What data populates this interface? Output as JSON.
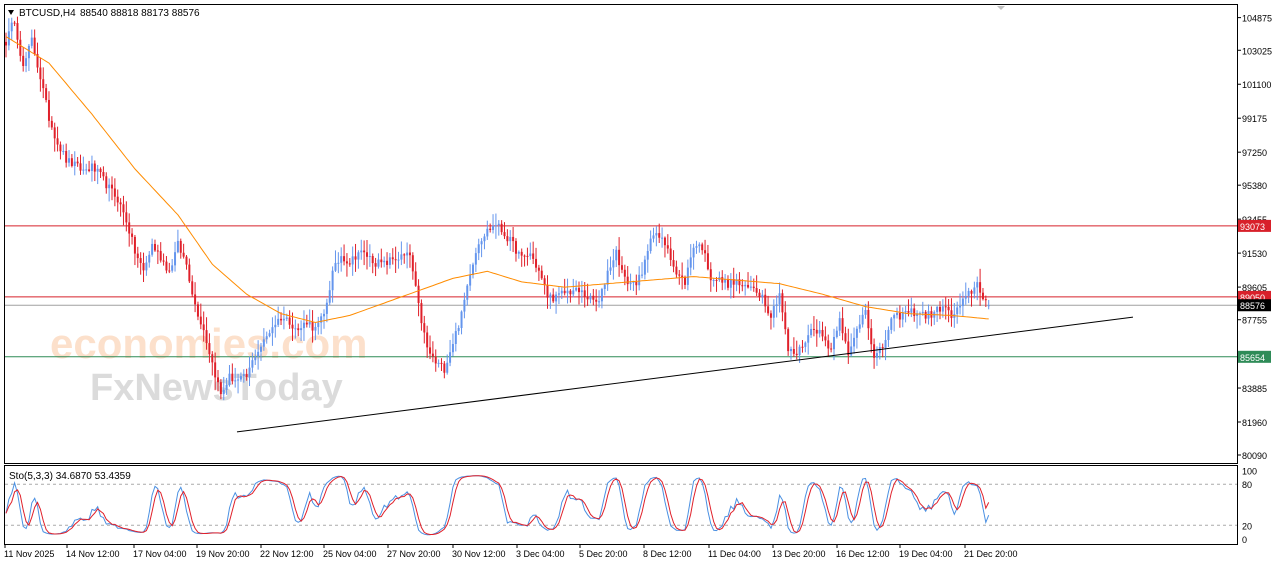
{
  "header": {
    "symbol": "BTCUSD,H4",
    "ohlc": "88540 88818 88173 88576",
    "menu_icon": "triangle-down-icon"
  },
  "watermark": {
    "line1": "economies.com",
    "line2": "FxNewsToday"
  },
  "colors": {
    "bull": "#6495ed",
    "bear": "#e0202a",
    "ma": "#ff8c00",
    "resistance": "#d8202a",
    "support": "#2e8b57",
    "price_line": "#a0a0a0",
    "trendline": "#000000",
    "stoch_main": "#4a90e2",
    "stoch_signal": "#e0202a"
  },
  "chart_data": [
    {
      "type": "candlestick",
      "title": "BTCUSD,H4",
      "ylim": [
        80090,
        105800
      ],
      "y_ticks": [
        "104875",
        "103025",
        "101100",
        "99175",
        "97250",
        "95380",
        "93455",
        "91530",
        "89605",
        "87755",
        "85830",
        "83885",
        "81960",
        "80090"
      ],
      "x_ticks": [
        "11 Nov 2025",
        "14 Nov 12:00",
        "17 Nov 04:00",
        "19 Nov 20:00",
        "22 Nov 12:00",
        "25 Nov 04:00",
        "27 Nov 20:00",
        "30 Nov 12:00",
        "3 Dec 04:00",
        "5 Dec 20:00",
        "8 Dec 12:00",
        "11 Dec 04:00",
        "13 Dec 20:00",
        "16 Dec 12:00",
        "19 Dec 04:00",
        "21 Dec 20:00"
      ],
      "horizontal_levels": [
        {
          "label": "93073",
          "value": 93073,
          "kind": "resistance"
        },
        {
          "label": "89050",
          "value": 89050,
          "kind": "resistance"
        },
        {
          "label": "88576",
          "value": 88576,
          "kind": "current"
        },
        {
          "label": "85654",
          "value": 85654,
          "kind": "support"
        }
      ],
      "trendline": {
        "from": {
          "x": "20 Nov",
          "y": 81400
        },
        "to": {
          "x": "23 Dec",
          "y": 87900
        }
      },
      "close_anchors": [
        [
          0,
          103500
        ],
        [
          3,
          104800
        ],
        [
          6,
          102000
        ],
        [
          9,
          103600
        ],
        [
          12,
          101500
        ],
        [
          15,
          99200
        ],
        [
          18,
          97800
        ],
        [
          21,
          96800
        ],
        [
          24,
          96500
        ],
        [
          27,
          96200
        ],
        [
          30,
          96400
        ],
        [
          33,
          95900
        ],
        [
          36,
          95200
        ],
        [
          39,
          94600
        ],
        [
          42,
          93400
        ],
        [
          45,
          91600
        ],
        [
          48,
          90500
        ],
        [
          51,
          92000
        ],
        [
          54,
          91300
        ],
        [
          57,
          90500
        ],
        [
          60,
          92000
        ],
        [
          63,
          90900
        ],
        [
          66,
          88600
        ],
        [
          69,
          87200
        ],
        [
          72,
          85300
        ],
        [
          75,
          83500
        ],
        [
          78,
          84500
        ],
        [
          81,
          84300
        ],
        [
          84,
          84500
        ],
        [
          87,
          85800
        ],
        [
          90,
          86500
        ],
        [
          93,
          87400
        ],
        [
          96,
          87900
        ],
        [
          99,
          87700
        ],
        [
          102,
          87100
        ],
        [
          105,
          87700
        ],
        [
          108,
          87200
        ],
        [
          111,
          88000
        ],
        [
          114,
          90400
        ],
        [
          117,
          91400
        ],
        [
          120,
          91000
        ],
        [
          123,
          91600
        ],
        [
          126,
          91400
        ],
        [
          129,
          91000
        ],
        [
          132,
          90900
        ],
        [
          135,
          91200
        ],
        [
          138,
          91300
        ],
        [
          141,
          91400
        ],
        [
          144,
          88500
        ],
        [
          147,
          86100
        ],
        [
          150,
          85300
        ],
        [
          153,
          85000
        ],
        [
          156,
          86500
        ],
        [
          159,
          88000
        ],
        [
          162,
          90500
        ],
        [
          165,
          92200
        ],
        [
          168,
          92800
        ],
        [
          171,
          93200
        ],
        [
          174,
          92600
        ],
        [
          177,
          92000
        ],
        [
          180,
          91200
        ],
        [
          183,
          91500
        ],
        [
          186,
          90500
        ],
        [
          189,
          89100
        ],
        [
          192,
          89000
        ],
        [
          195,
          89300
        ],
        [
          198,
          89400
        ],
        [
          201,
          89300
        ],
        [
          204,
          88900
        ],
        [
          207,
          88700
        ],
        [
          210,
          90500
        ],
        [
          213,
          91600
        ],
        [
          216,
          90000
        ],
        [
          219,
          89800
        ],
        [
          222,
          90200
        ],
        [
          225,
          92600
        ],
        [
          228,
          92400
        ],
        [
          231,
          91900
        ],
        [
          234,
          90300
        ],
        [
          237,
          89900
        ],
        [
          240,
          92000
        ],
        [
          243,
          91900
        ],
        [
          246,
          90200
        ],
        [
          249,
          90000
        ],
        [
          252,
          89800
        ],
        [
          255,
          89900
        ],
        [
          258,
          89500
        ],
        [
          261,
          89600
        ],
        [
          264,
          89100
        ],
        [
          267,
          88000
        ],
        [
          270,
          89300
        ],
        [
          273,
          86000
        ],
        [
          276,
          85800
        ],
        [
          279,
          86600
        ],
        [
          282,
          87400
        ],
        [
          285,
          86800
        ],
        [
          288,
          86100
        ],
        [
          291,
          88000
        ],
        [
          294,
          85600
        ],
        [
          297,
          87200
        ],
        [
          300,
          88500
        ],
        [
          303,
          85500
        ],
        [
          306,
          86200
        ],
        [
          309,
          87700
        ],
        [
          312,
          88000
        ],
        [
          315,
          88200
        ],
        [
          318,
          88200
        ],
        [
          321,
          88000
        ],
        [
          324,
          88100
        ],
        [
          327,
          88600
        ],
        [
          330,
          87900
        ],
        [
          333,
          88500
        ],
        [
          336,
          89200
        ],
        [
          339,
          89800
        ],
        [
          341,
          89100
        ],
        [
          343,
          88576
        ]
      ],
      "ma_anchors": [
        [
          0,
          103800
        ],
        [
          15,
          102300
        ],
        [
          30,
          99400
        ],
        [
          45,
          96300
        ],
        [
          60,
          93700
        ],
        [
          72,
          90900
        ],
        [
          84,
          89200
        ],
        [
          96,
          88100
        ],
        [
          108,
          87600
        ],
        [
          120,
          88000
        ],
        [
          132,
          88700
        ],
        [
          144,
          89400
        ],
        [
          156,
          90100
        ],
        [
          168,
          90500
        ],
        [
          180,
          89900
        ],
        [
          195,
          89600
        ],
        [
          210,
          89800
        ],
        [
          225,
          90000
        ],
        [
          240,
          90200
        ],
        [
          255,
          90000
        ],
        [
          270,
          89800
        ],
        [
          285,
          89200
        ],
        [
          300,
          88500
        ],
        [
          315,
          88100
        ],
        [
          330,
          88000
        ],
        [
          343,
          87800
        ]
      ],
      "bar_count": 344
    },
    {
      "type": "line",
      "title": "Sto(5,3,3) 34.6870 53.4359",
      "series": [
        {
          "name": "Main",
          "role": "main"
        },
        {
          "name": "Signal",
          "role": "signal"
        }
      ],
      "ylim": [
        0,
        100
      ],
      "y_ticks": [
        "100",
        "80",
        "20",
        "0"
      ],
      "levels": [
        80,
        20
      ],
      "last_main": 34.687,
      "last_signal": 53.4359
    }
  ]
}
